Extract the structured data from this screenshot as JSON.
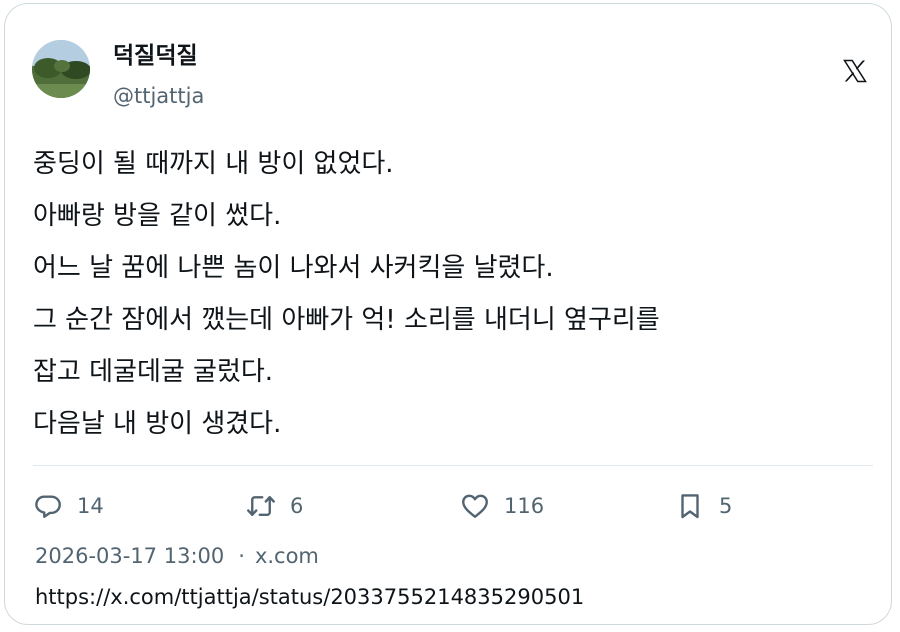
{
  "author": {
    "display_name": "덕질덕질",
    "handle": "@ttjattja"
  },
  "brand": {
    "logo_icon": "x-logo-icon"
  },
  "tweet": {
    "lines": [
      "중딩이 될 때까지 내 방이 없었다.",
      "아빠랑 방을 같이 썼다.",
      "어느 날 꿈에 나쁜 놈이 나와서 사커킥을 날렸다.",
      "그 순간 잠에서 깼는데 아빠가 억! 소리를 내더니 옆구리를",
      "잡고 데굴데굴 굴렀다.",
      "다음날 내 방이 생겼다."
    ]
  },
  "actions": {
    "reply": {
      "icon": "reply-icon",
      "count": "14"
    },
    "retweet": {
      "icon": "retweet-icon",
      "count": "6"
    },
    "like": {
      "icon": "heart-icon",
      "count": "116"
    },
    "bookmark": {
      "icon": "bookmark-icon",
      "count": "5"
    }
  },
  "meta": {
    "timestamp": "2026-03-17 13:00",
    "separator": "·",
    "source": "x.com"
  },
  "url": "https://x.com/ttjattja/status/2033755214835290501",
  "colors": {
    "text_primary": "#0f1419",
    "text_secondary": "#536471",
    "border": "#cfd9de"
  }
}
